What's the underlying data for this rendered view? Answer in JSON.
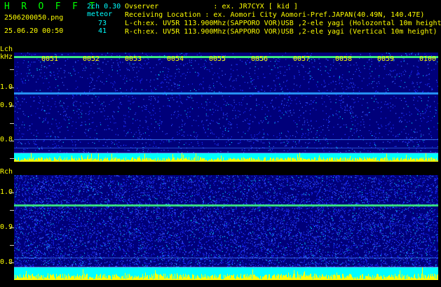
{
  "header": {
    "app_title": "H R O F F T",
    "version": "2ch 0.30",
    "file_name": "2506200050.png",
    "meteor_label": "meteor",
    "l_count": "73",
    "r_count": "41",
    "timestamp": "25.06.20 00:50",
    "info_lines": [
      "Ovserver             : ex. JR7CYX [ kid ]",
      "Receiving Location : ex. Aomori City Aomori-Pref.JAPAN(40.49N, 140.47E)",
      "L-ch:ex. UV5R 113.900Mhz(SAPPORO VOR)USB ,2-ele yagi (Holozontal 10m height)",
      "R-ch:ex. UV5R 113.900Mhz(SAPPORO VOR)USB ,2-ele yagi (Vertical 10m height)"
    ]
  },
  "lch": {
    "channel_label": "Lch",
    "unit_label": "kHz",
    "y_ticks": [
      "1.0",
      "0.9",
      "0.8"
    ],
    "time_labels": [
      "0051",
      "0052",
      "0053",
      "0054",
      "0055",
      "0056",
      "0057",
      "0058",
      "0059",
      "0100"
    ]
  },
  "rch": {
    "channel_label": "Rch",
    "y_ticks": [
      "1.0",
      "0.9",
      "0.8"
    ]
  },
  "colors": {
    "background": "#000000",
    "spectrogram_base": "#00007a",
    "signal_line": "#40ff80",
    "reference_line": "#4080ff",
    "level_cyan": "#00ffff",
    "level_yellow": "#ffff00",
    "title_green": "#00ff00",
    "text_cyan": "#00ffff",
    "text_yellow": "#ffff00"
  }
}
